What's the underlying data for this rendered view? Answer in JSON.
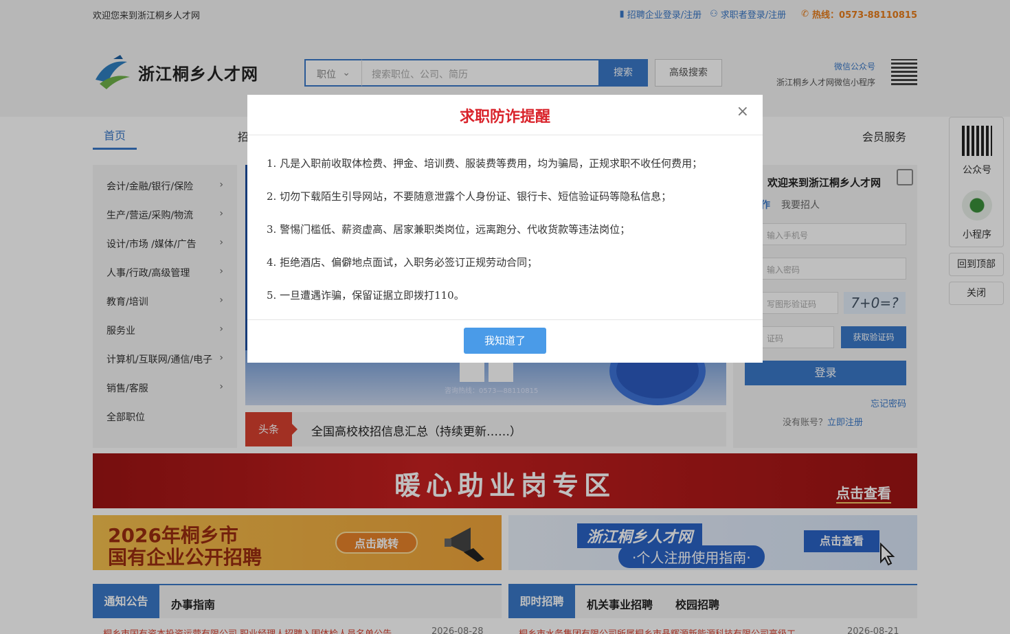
{
  "topbar": {
    "welcome": "欢迎您来到浙江桐乡人才网",
    "employer_login": "招聘企业登录/注册",
    "seeker_login": "求职者登录/注册",
    "hotline": "热线：0573-88110815"
  },
  "header": {
    "logo_text": "浙江桐乡人才网",
    "search_category": "职位",
    "search_placeholder": "搜索职位、公司、简历",
    "search_button": "搜索",
    "advanced_search": "高级搜索",
    "wechat_official": "微信公众号",
    "wechat_mini": "浙江桐乡人才网微信小程序"
  },
  "nav": {
    "home": "首页",
    "recruit": "招",
    "member": "会员服务"
  },
  "sidebar": {
    "items": [
      {
        "label": "会计/金融/银行/保险",
        "arrow": "›"
      },
      {
        "label": "生产/营运/采购/物流",
        "arrow": "›"
      },
      {
        "label": "设计/市场 /媒体/广告",
        "arrow": "›"
      },
      {
        "label": "人事/行政/高级管理",
        "arrow": "›"
      },
      {
        "label": "教育/培训",
        "arrow": "›"
      },
      {
        "label": "服务业",
        "arrow": "›"
      },
      {
        "label": "计算机/互联网/通信/电子",
        "arrow": "›"
      },
      {
        "label": "销售/客服",
        "arrow": "›"
      },
      {
        "label": "全部职位",
        "arrow": ""
      }
    ]
  },
  "banner": {
    "hotline": "咨询热线：0573—88110815"
  },
  "headline": {
    "tag": "头条",
    "text": "全国高校校招信息汇总（持续更新……）"
  },
  "login": {
    "title": "欢迎来到浙江桐乡人才网",
    "tab_job": "作",
    "tab_hire": "我要招人",
    "phone_placeholder": "输入手机号",
    "password_placeholder": "输入密码",
    "captcha_placeholder": "写图形验证码",
    "captcha_image": "7+0=?",
    "sms_placeholder": "证码",
    "get_code": "获取验证码",
    "login_button": "登录",
    "forgot": "忘记密码",
    "no_account": "没有账号？",
    "register": "立即注册"
  },
  "floatbar": {
    "official": "公众号",
    "mini": "小程序",
    "top": "回到顶部",
    "close": "关闭"
  },
  "promos": {
    "main_title": "暖心助业岗专区",
    "main_cta": "点击查看",
    "left_line1": "2026年桐乡市",
    "left_line2": "国有企业公开招聘",
    "left_cta": "点击跳转",
    "right_line1": "浙江桐乡人才网",
    "right_line2": "·个人注册使用指南·",
    "right_cta": "点击查看"
  },
  "sections": {
    "left_tab_active": "通知公告",
    "left_tab2": "办事指南",
    "right_tab_active": "即时招聘",
    "right_tab2": "机关事业招聘",
    "right_tab3": "校园招聘",
    "left_row": "桐乡市国有资本投资运营有限公司 职业经理人招聘入围体检人员名单公告",
    "left_date": "2026-08-28",
    "right_row": "桐乡市水务集团有限公司所属桐乡市晶辉源新能源科技有限公司高级工",
    "right_date": "2026-08-21"
  },
  "modal": {
    "title": "求职防诈提醒",
    "close": "×",
    "lines": [
      "1. 凡是入职前收取体检费、押金、培训费、服装费等费用，均为骗局，正规求职不收任何费用；",
      "2. 切勿下载陌生引导网站，不要随意泄露个人身份证、银行卡、短信验证码等隐私信息；",
      "3. 警惕门槛低、薪资虚高、居家兼职类岗位，远离跑分、代收货款等违法岗位；",
      "4. 拒绝酒店、偏僻地点面试，入职务必签订正规劳动合同；",
      "5. 一旦遭遇诈骗，保留证据立即拨打110。"
    ],
    "ok": "我知道了"
  }
}
